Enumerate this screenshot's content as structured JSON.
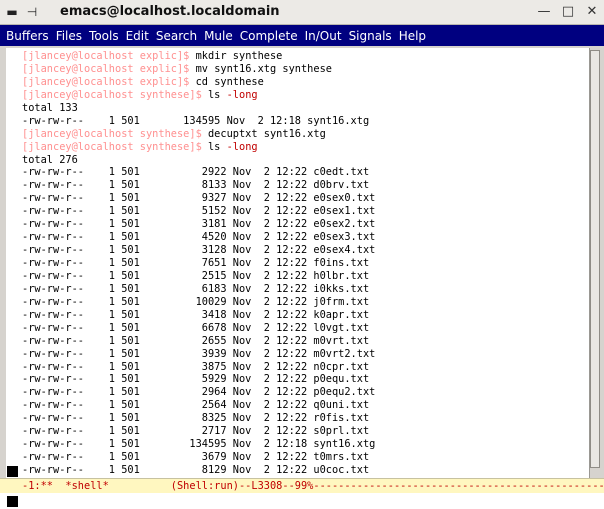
{
  "window": {
    "title": "emacs@localhost.localdomain",
    "left_icons": [
      "menu-icon",
      "pin-icon"
    ],
    "controls": [
      "minimize-icon",
      "maximize-icon",
      "close-icon"
    ]
  },
  "menubar": [
    "Buffers",
    "Files",
    "Tools",
    "Edit",
    "Search",
    "Mule",
    "Complete",
    "In/Out",
    "Signals",
    "Help"
  ],
  "terminal": {
    "lines": [
      {
        "prompt": "[jlancey@localhost explic]$ ",
        "cmd": "mkdir synthese",
        "opt": ""
      },
      {
        "prompt": "[jlancey@localhost explic]$ ",
        "cmd": "mv synt16.xtg synthese",
        "opt": ""
      },
      {
        "prompt": "[jlancey@localhost explic]$ ",
        "cmd": "cd synthese",
        "opt": ""
      },
      {
        "prompt": "[jlancey@localhost synthese]$ ",
        "cmd": "ls ",
        "opt": "-long"
      },
      {
        "prompt": "",
        "cmd": "total 133",
        "opt": ""
      },
      {
        "prompt": "",
        "cmd": "-rw-rw-r--    1 501       134595 Nov  2 12:18 synt16.xtg",
        "opt": ""
      },
      {
        "prompt": "[jlancey@localhost synthese]$ ",
        "cmd": "decuptxt synt16.xtg",
        "opt": ""
      },
      {
        "prompt": "[jlancey@localhost synthese]$ ",
        "cmd": "ls ",
        "opt": "-long"
      },
      {
        "prompt": "",
        "cmd": "total 276",
        "opt": ""
      },
      {
        "prompt": "",
        "cmd": "-rw-rw-r--    1 501          2922 Nov  2 12:22 c0edt.txt",
        "opt": ""
      },
      {
        "prompt": "",
        "cmd": "-rw-rw-r--    1 501          8133 Nov  2 12:22 d0brv.txt",
        "opt": ""
      },
      {
        "prompt": "",
        "cmd": "-rw-rw-r--    1 501          9327 Nov  2 12:22 e0sex0.txt",
        "opt": ""
      },
      {
        "prompt": "",
        "cmd": "-rw-rw-r--    1 501          5152 Nov  2 12:22 e0sex1.txt",
        "opt": ""
      },
      {
        "prompt": "",
        "cmd": "-rw-rw-r--    1 501          3181 Nov  2 12:22 e0sex2.txt",
        "opt": ""
      },
      {
        "prompt": "",
        "cmd": "-rw-rw-r--    1 501          4520 Nov  2 12:22 e0sex3.txt",
        "opt": ""
      },
      {
        "prompt": "",
        "cmd": "-rw-rw-r--    1 501          3128 Nov  2 12:22 e0sex4.txt",
        "opt": ""
      },
      {
        "prompt": "",
        "cmd": "-rw-rw-r--    1 501          7651 Nov  2 12:22 f0ins.txt",
        "opt": ""
      },
      {
        "prompt": "",
        "cmd": "-rw-rw-r--    1 501          2515 Nov  2 12:22 h0lbr.txt",
        "opt": ""
      },
      {
        "prompt": "",
        "cmd": "-rw-rw-r--    1 501          6183 Nov  2 12:22 i0kks.txt",
        "opt": ""
      },
      {
        "prompt": "",
        "cmd": "-rw-rw-r--    1 501         10029 Nov  2 12:22 j0frm.txt",
        "opt": ""
      },
      {
        "prompt": "",
        "cmd": "-rw-rw-r--    1 501          3418 Nov  2 12:22 k0apr.txt",
        "opt": ""
      },
      {
        "prompt": "",
        "cmd": "-rw-rw-r--    1 501          6678 Nov  2 12:22 l0vgt.txt",
        "opt": ""
      },
      {
        "prompt": "",
        "cmd": "-rw-rw-r--    1 501          2655 Nov  2 12:22 m0vrt.txt",
        "opt": ""
      },
      {
        "prompt": "",
        "cmd": "-rw-rw-r--    1 501          3939 Nov  2 12:22 m0vrt2.txt",
        "opt": ""
      },
      {
        "prompt": "",
        "cmd": "-rw-rw-r--    1 501          3875 Nov  2 12:22 n0cpr.txt",
        "opt": ""
      },
      {
        "prompt": "",
        "cmd": "-rw-rw-r--    1 501          5929 Nov  2 12:22 p0equ.txt",
        "opt": ""
      },
      {
        "prompt": "",
        "cmd": "-rw-rw-r--    1 501          2964 Nov  2 12:22 p0equ2.txt",
        "opt": ""
      },
      {
        "prompt": "",
        "cmd": "-rw-rw-r--    1 501          2564 Nov  2 12:22 q0uni.txt",
        "opt": ""
      },
      {
        "prompt": "",
        "cmd": "-rw-rw-r--    1 501          8325 Nov  2 12:22 r0fis.txt",
        "opt": ""
      },
      {
        "prompt": "",
        "cmd": "-rw-rw-r--    1 501          2717 Nov  2 12:22 s0prl.txt",
        "opt": ""
      },
      {
        "prompt": "",
        "cmd": "-rw-rw-r--    1 501        134595 Nov  2 12:18 synt16.xtg",
        "opt": ""
      },
      {
        "prompt": "",
        "cmd": "-rw-rw-r--    1 501          3679 Nov  2 12:22 t0mrs.txt",
        "opt": ""
      },
      {
        "prompt": "",
        "cmd": "-rw-rw-r--    1 501          8129 Nov  2 12:22 u0coc.txt",
        "opt": ""
      }
    ]
  },
  "modeline": "-1:**  *shell*          (Shell:run)--L3308--99%-------------------------------------------------",
  "colors": {
    "menubar_bg": "#000080",
    "prompt": "#ff9090",
    "option": "#c00000",
    "modeline_bg": "#fff7c0",
    "modeline_text": "#c00000"
  }
}
